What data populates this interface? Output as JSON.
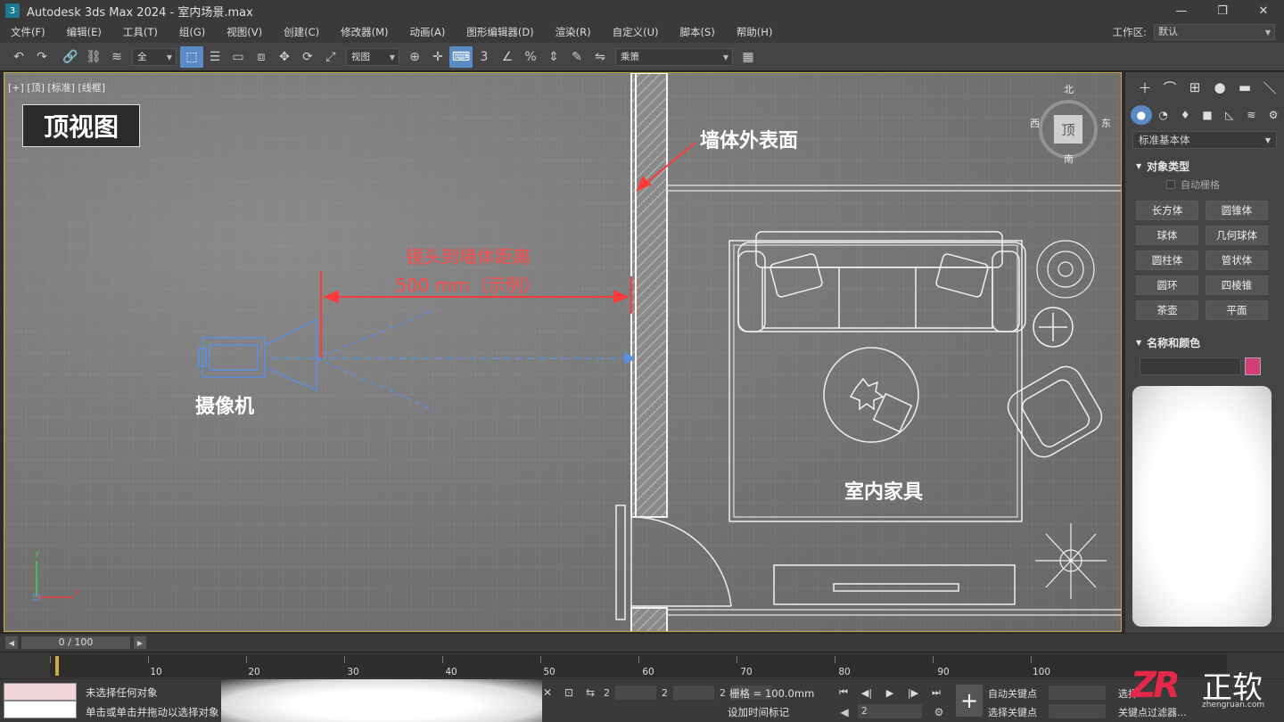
{
  "window": {
    "title": "Autodesk 3ds Max 2024  -  室内场景.max",
    "logo": "3",
    "minimize": "—",
    "maximize": "❐",
    "close": "✕"
  },
  "menu": {
    "items": [
      "文件(F)",
      "编辑(E)",
      "工具(T)",
      "组(G)",
      "视图(V)",
      "创建(C)",
      "修改器(M)",
      "动画(A)",
      "图形编辑器(D)",
      "渲染(R)",
      "自定义(U)",
      "脚本(S)",
      "帮助(H)"
    ],
    "workspace_label": "工作区:",
    "workspace_value": "默认"
  },
  "toolbar": {
    "selection_set": "全",
    "reference_coord": "视图",
    "named_selection": "乘箫"
  },
  "viewport": {
    "label": "[+] [顶] [标准] [线框]",
    "view_title": "顶视图",
    "annotations": {
      "wall_surface": "墙体外表面",
      "distance_line1": "镜头到墙体距离",
      "distance_line2": "500 mm（示例）",
      "camera": "摄像机",
      "furniture": "室内家具"
    },
    "viewcube": {
      "north": "北",
      "south": "南",
      "east": "东",
      "west": "西",
      "face": "顶"
    },
    "axis": {
      "x": "x",
      "y": "y"
    }
  },
  "command_panel": {
    "category": "标准基本体",
    "object_type_title": "对象类型",
    "autogrid": "自动栅格",
    "objects": [
      "长方体",
      "圆锥体",
      "球体",
      "几何球体",
      "圆柱体",
      "管状体",
      "圆环",
      "四棱锥",
      "茶壶",
      "平面"
    ],
    "name_color_title": "名称和颜色",
    "swatch_color": "#d13f78"
  },
  "timeline": {
    "frame_counter": "0 / 100",
    "ticks": [
      "10",
      "20",
      "30",
      "40",
      "50",
      "60",
      "70",
      "80",
      "90",
      "100"
    ]
  },
  "status": {
    "line1": "未选择任何对象",
    "line2": "单击或单击并拖动以选择对象",
    "grid": "栅格 = 100.0mm",
    "add_time_tag": "设加时间标记",
    "coord_x": "2",
    "coord_y": "2",
    "coord_z": "2",
    "frame_value": "2",
    "auto_key": "自动关键点",
    "set_key": "选择关键点",
    "selected": "选择",
    "key_filter": "关键点过滤器..."
  },
  "watermark": {
    "logo": "ZR",
    "name": "正软",
    "url": "zhengruan.com"
  }
}
